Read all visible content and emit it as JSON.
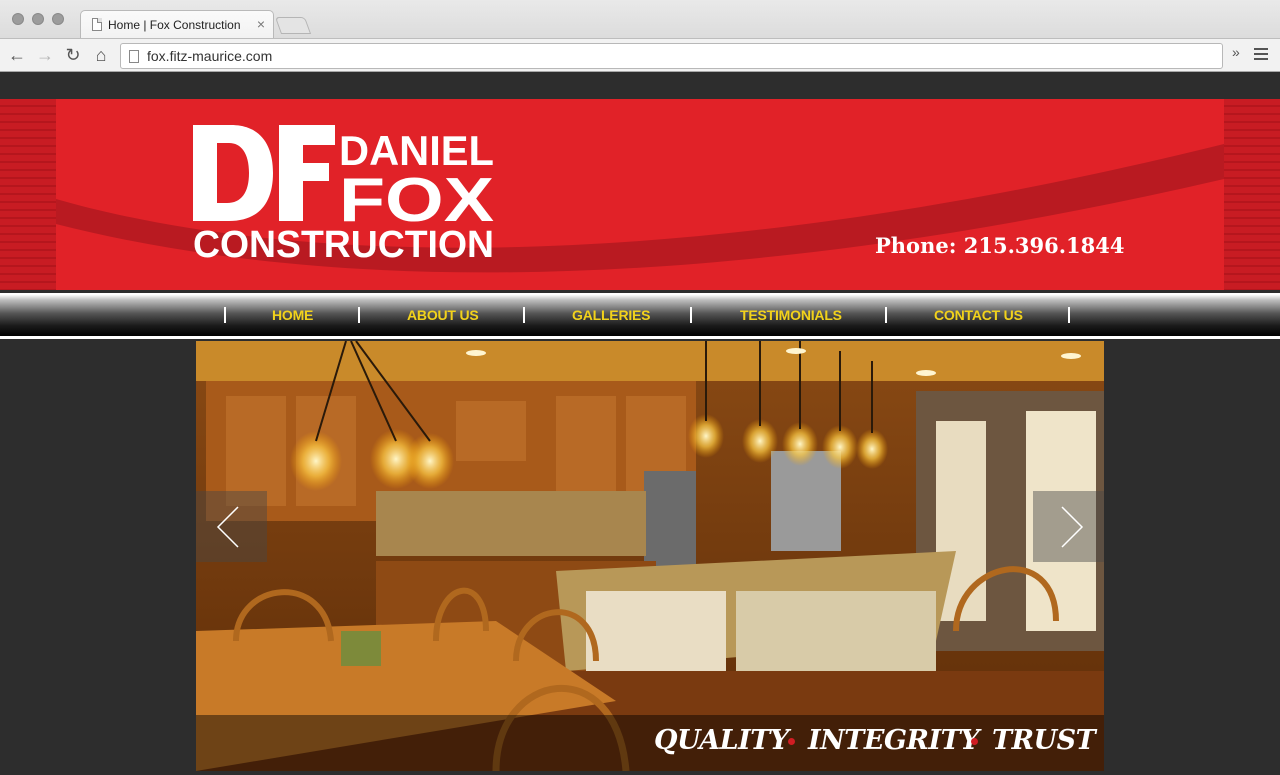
{
  "browser": {
    "tab_title": "Home | Fox Construction",
    "tab_close": "×",
    "url": "fox.fitz-maurice.com",
    "back": "←",
    "forward": "→",
    "reload": "↻",
    "home": "⌂",
    "extensions": "»"
  },
  "site": {
    "logo": {
      "daniel": "DANIEL",
      "fox": "FOX",
      "construction": "CONSTRUCTION",
      "monogram": "DF"
    },
    "phone": "Phone: 215.396.1844",
    "nav": [
      "HOME",
      "ABOUT US",
      "GALLERIES",
      "TESTIMONIALS",
      "CONTACT US"
    ],
    "slider": {
      "caption_words": [
        "QUALITY",
        "INTEGRITY",
        "TRUST"
      ],
      "prev_arrow": "‹",
      "next_arrow": "›"
    }
  },
  "colors": {
    "brand_red": "#e12228",
    "nav_text": "#f2d21b",
    "background": "#2d2d2d",
    "caption_dot": "#d11d23"
  }
}
